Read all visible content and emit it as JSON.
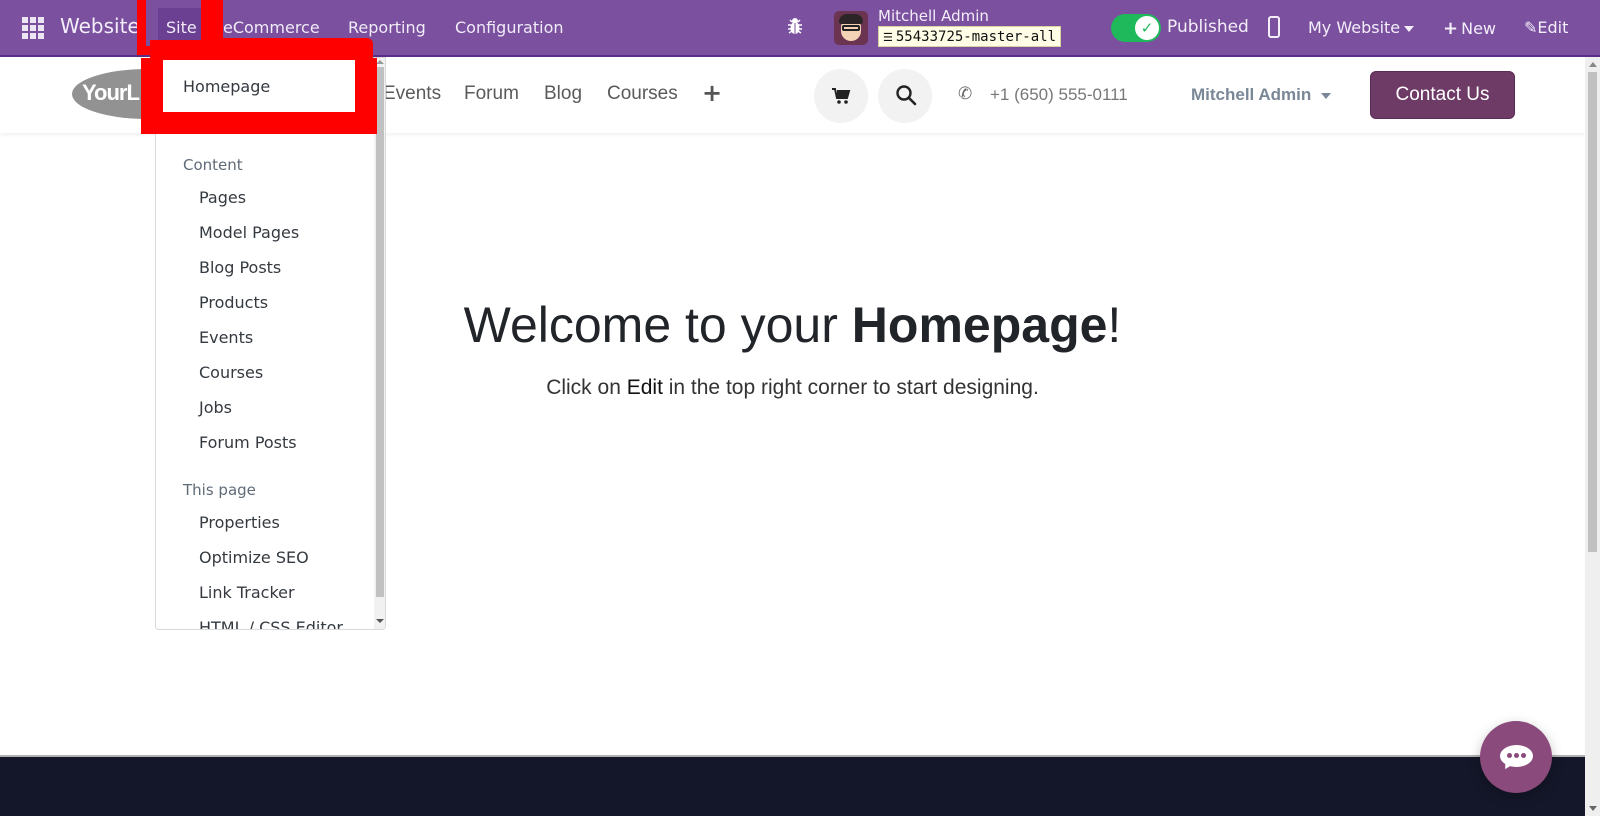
{
  "topbar": {
    "app_name": "Website",
    "menu": [
      "Site",
      "eCommerce",
      "Reporting",
      "Configuration"
    ],
    "user_name": "Mitchell Admin",
    "database": "55433725-master-all",
    "published_label": "Published",
    "published": true,
    "website_selector": "My Website",
    "new_label": "New",
    "edit_label": "Edit",
    "colors": {
      "bar": "#7a509f",
      "toggle_on": "#1fb85a"
    }
  },
  "site_header": {
    "logo_text": "YourL",
    "nav": [
      "Events",
      "Forum",
      "Blog",
      "Courses"
    ],
    "phone": "+1 (650) 555-0111",
    "user_menu": "Mitchell Admin",
    "contact_label": "Contact Us",
    "colors": {
      "contact_button": "#6d3b65"
    }
  },
  "dropdown": {
    "top_item": "Homepage",
    "sections": [
      {
        "header": "Content",
        "items": [
          "Pages",
          "Model Pages",
          "Blog Posts",
          "Products",
          "Events",
          "Courses",
          "Jobs",
          "Forum Posts"
        ]
      },
      {
        "header": "This page",
        "items": [
          "Properties",
          "Optimize SEO",
          "Link Tracker",
          "HTML / CSS Editor"
        ]
      }
    ]
  },
  "hero": {
    "title_prefix": "Welcome to your ",
    "title_bold": "Homepage",
    "title_suffix": "!",
    "subtitle_prefix": "Click on ",
    "subtitle_em": "Edit",
    "subtitle_suffix": " in the top right corner to start designing."
  },
  "annotation": {
    "color": "#ff0000",
    "target": "Homepage"
  }
}
